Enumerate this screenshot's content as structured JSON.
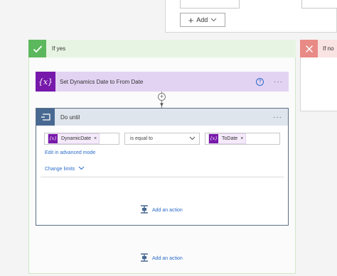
{
  "top": {
    "add_label": "Add"
  },
  "yes_branch": {
    "label": "If yes"
  },
  "no_branch": {
    "label": "If no"
  },
  "set_action": {
    "icon_text": "{x}",
    "title": "Set Dynamics Date to From Date",
    "help": "?",
    "more": "···"
  },
  "connector": {
    "plus": "+",
    "arrow": "▼"
  },
  "do_until": {
    "title": "Do until",
    "more": "···",
    "left_token": {
      "icon": "{x}",
      "label": "DynamicDate",
      "remove": "×"
    },
    "operator": "is equal to",
    "right_token": {
      "icon": "{x}",
      "label": "ToDate",
      "remove": "×"
    },
    "advanced_link": "Edit in advanced mode",
    "change_limits": "Change limits",
    "add_action": "Add an action"
  },
  "outer_add_action": "Add an action",
  "icons": {
    "check": "check-icon",
    "close": "close-icon",
    "variable": "variable-icon",
    "loop": "loop-icon",
    "add_action": "add-action-icon",
    "help": "help-icon",
    "chevron": "chevron-down-icon"
  },
  "colors": {
    "yes_accent": "#5cb85c",
    "no_accent": "#e88a85",
    "variable_purple": "#7719aa",
    "loop_blue": "#486991",
    "link_blue": "#2b6cc9"
  }
}
